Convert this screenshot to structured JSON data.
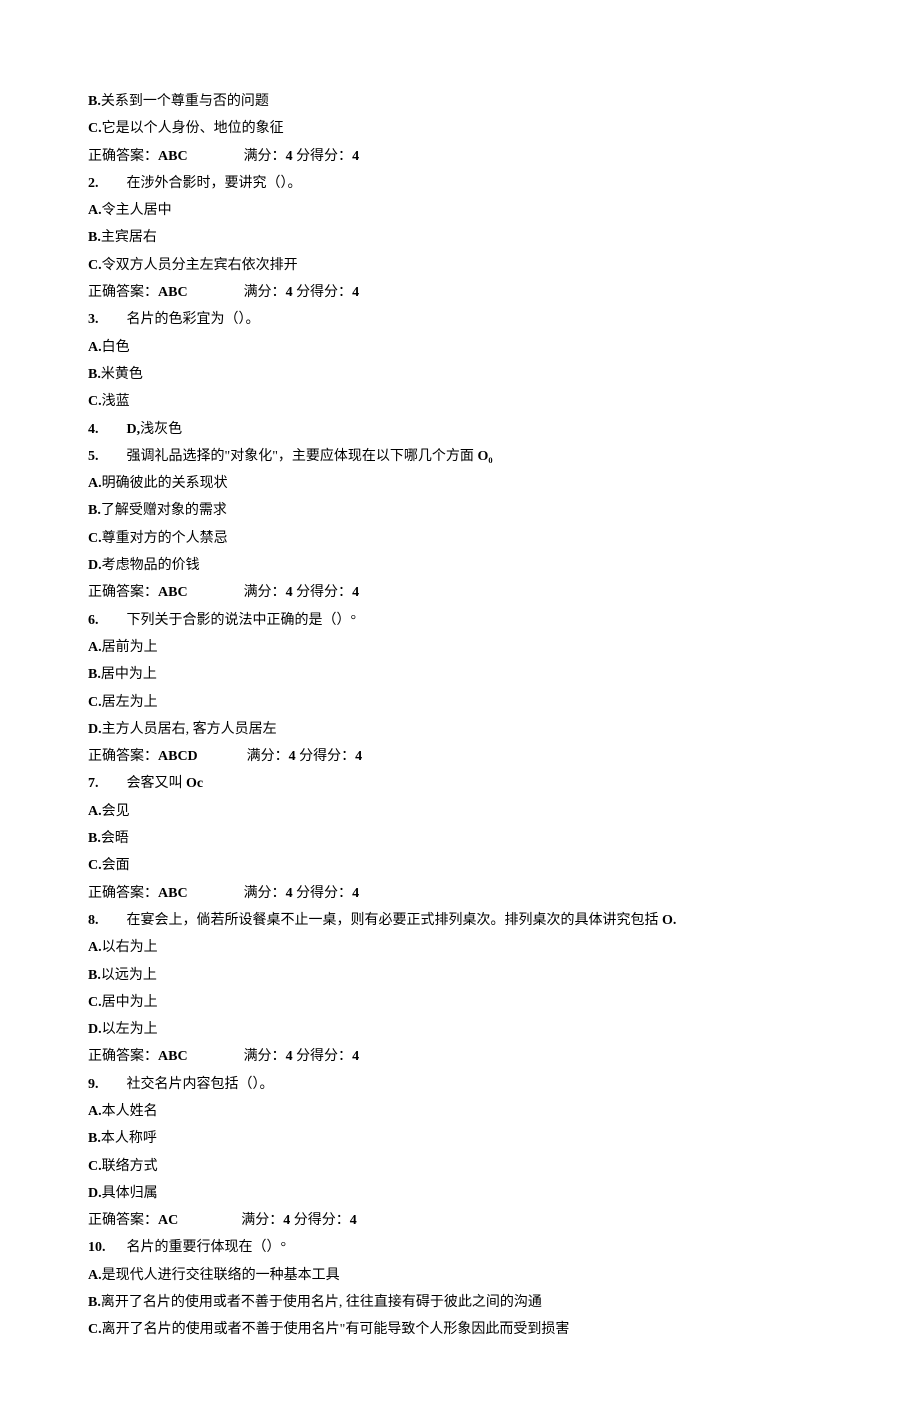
{
  "lines": [
    {
      "segments": [
        {
          "text": "B.",
          "bold": true
        },
        {
          "text": "关系到一个尊重与否的问题"
        }
      ]
    },
    {
      "segments": [
        {
          "text": "C.",
          "bold": true
        },
        {
          "text": "它是以个人身份、地位的象征"
        }
      ]
    },
    {
      "segments": [
        {
          "text": "正确答案：",
          "bold": false
        },
        {
          "text": "ABC",
          "bold": true
        },
        {
          "text": "                满分：",
          "bold": false
        },
        {
          "text": "4",
          "bold": true
        },
        {
          "text": " 分得分：",
          "bold": false
        },
        {
          "text": "4",
          "bold": true
        }
      ]
    },
    {
      "segments": [
        {
          "text": "2.",
          "bold": true
        },
        {
          "text": "        在涉外合影时，要讲究（）。"
        }
      ]
    },
    {
      "segments": [
        {
          "text": "A.",
          "bold": true
        },
        {
          "text": "令主人居中"
        }
      ]
    },
    {
      "segments": [
        {
          "text": "B.",
          "bold": true
        },
        {
          "text": "主宾居右"
        }
      ]
    },
    {
      "segments": [
        {
          "text": "C.",
          "bold": true
        },
        {
          "text": "令双方人员分主左宾右依次排开"
        }
      ]
    },
    {
      "segments": [
        {
          "text": "正确答案：",
          "bold": false
        },
        {
          "text": "ABC",
          "bold": true
        },
        {
          "text": "                满分：",
          "bold": false
        },
        {
          "text": "4",
          "bold": true
        },
        {
          "text": " 分得分：",
          "bold": false
        },
        {
          "text": "4",
          "bold": true
        }
      ]
    },
    {
      "segments": [
        {
          "text": "3.",
          "bold": true
        },
        {
          "text": "        名片的色彩宜为（）。"
        }
      ]
    },
    {
      "segments": [
        {
          "text": "A.",
          "bold": true
        },
        {
          "text": "白色"
        }
      ]
    },
    {
      "segments": [
        {
          "text": "B.",
          "bold": true
        },
        {
          "text": "米黄色"
        }
      ]
    },
    {
      "segments": [
        {
          "text": "C.",
          "bold": true
        },
        {
          "text": "浅蓝"
        }
      ]
    },
    {
      "segments": [
        {
          "text": "4.        D,",
          "bold": true
        },
        {
          "text": "浅灰色"
        }
      ]
    },
    {
      "segments": [
        {
          "text": "5.",
          "bold": true
        },
        {
          "text": "        强调礼品选择的\"对象化\"，主要应体现在以下哪几个方面 ",
          "bold": false
        },
        {
          "text": "O₀",
          "bold": true
        }
      ]
    },
    {
      "segments": [
        {
          "text": "A.",
          "bold": true
        },
        {
          "text": "明确彼此的关系现状"
        }
      ]
    },
    {
      "segments": [
        {
          "text": "B.",
          "bold": true
        },
        {
          "text": "了解受赠对象的需求"
        }
      ]
    },
    {
      "segments": [
        {
          "text": "C.",
          "bold": true
        },
        {
          "text": "尊重对方的个人禁忌"
        }
      ]
    },
    {
      "segments": [
        {
          "text": "D.",
          "bold": true
        },
        {
          "text": "考虑物品的价钱"
        }
      ]
    },
    {
      "segments": [
        {
          "text": "正确答案：",
          "bold": false
        },
        {
          "text": "ABC",
          "bold": true
        },
        {
          "text": "                满分：",
          "bold": false
        },
        {
          "text": "4",
          "bold": true
        },
        {
          "text": " 分得分：",
          "bold": false
        },
        {
          "text": "4",
          "bold": true
        }
      ]
    },
    {
      "segments": [
        {
          "text": "6.",
          "bold": true
        },
        {
          "text": "        下列关于合影的说法中正确的是（）°"
        }
      ]
    },
    {
      "segments": [
        {
          "text": "A.",
          "bold": true
        },
        {
          "text": "居前为上"
        }
      ]
    },
    {
      "segments": [
        {
          "text": "B.",
          "bold": true
        },
        {
          "text": "居中为上"
        }
      ]
    },
    {
      "segments": [
        {
          "text": "C.",
          "bold": true
        },
        {
          "text": "居左为上"
        }
      ]
    },
    {
      "segments": [
        {
          "text": "D.",
          "bold": true
        },
        {
          "text": "主方人员居右, 客方人员居左"
        }
      ]
    },
    {
      "segments": [
        {
          "text": "正确答案：",
          "bold": false
        },
        {
          "text": "ABCD",
          "bold": true
        },
        {
          "text": "              满分：",
          "bold": false
        },
        {
          "text": "4",
          "bold": true
        },
        {
          "text": " 分得分：",
          "bold": false
        },
        {
          "text": "4",
          "bold": true
        }
      ]
    },
    {
      "segments": [
        {
          "text": "7.",
          "bold": true
        },
        {
          "text": "        会客又叫 ",
          "bold": false
        },
        {
          "text": "Oc",
          "bold": true
        }
      ]
    },
    {
      "segments": [
        {
          "text": "A.",
          "bold": true
        },
        {
          "text": "会见"
        }
      ]
    },
    {
      "segments": [
        {
          "text": "B.",
          "bold": true
        },
        {
          "text": "会晤"
        }
      ]
    },
    {
      "segments": [
        {
          "text": "C.",
          "bold": true
        },
        {
          "text": "会面"
        }
      ]
    },
    {
      "segments": [
        {
          "text": "正确答案：",
          "bold": false
        },
        {
          "text": "ABC",
          "bold": true
        },
        {
          "text": "                满分：",
          "bold": false
        },
        {
          "text": "4",
          "bold": true
        },
        {
          "text": " 分得分：",
          "bold": false
        },
        {
          "text": "4",
          "bold": true
        }
      ]
    },
    {
      "segments": [
        {
          "text": "8.",
          "bold": true
        },
        {
          "text": "        在宴会上，倘若所设餐桌不止一桌，则有必要正式排列桌次。排列桌次的具体讲究包括 ",
          "bold": false
        },
        {
          "text": "O.",
          "bold": true
        }
      ]
    },
    {
      "segments": [
        {
          "text": "A.",
          "bold": true
        },
        {
          "text": "以右为上"
        }
      ]
    },
    {
      "segments": [
        {
          "text": "B.",
          "bold": true
        },
        {
          "text": "以远为上"
        }
      ]
    },
    {
      "segments": [
        {
          "text": "C.",
          "bold": true
        },
        {
          "text": "居中为上"
        }
      ]
    },
    {
      "segments": [
        {
          "text": "D.",
          "bold": true
        },
        {
          "text": "以左为上"
        }
      ]
    },
    {
      "segments": [
        {
          "text": "正确答案：",
          "bold": false
        },
        {
          "text": "ABC",
          "bold": true
        },
        {
          "text": "                满分：",
          "bold": false
        },
        {
          "text": "4",
          "bold": true
        },
        {
          "text": " 分得分：",
          "bold": false
        },
        {
          "text": "4",
          "bold": true
        }
      ]
    },
    {
      "segments": [
        {
          "text": "9.",
          "bold": true
        },
        {
          "text": "        社交名片内容包括（）。"
        }
      ]
    },
    {
      "segments": [
        {
          "text": "A.",
          "bold": true
        },
        {
          "text": "本人姓名"
        }
      ]
    },
    {
      "segments": [
        {
          "text": "B.",
          "bold": true
        },
        {
          "text": "本人称呼"
        }
      ]
    },
    {
      "segments": [
        {
          "text": "C.",
          "bold": true
        },
        {
          "text": "联络方式"
        }
      ]
    },
    {
      "segments": [
        {
          "text": "D.",
          "bold": true
        },
        {
          "text": "具体归属"
        }
      ]
    },
    {
      "segments": [
        {
          "text": "正确答案：",
          "bold": false
        },
        {
          "text": "AC",
          "bold": true
        },
        {
          "text": "                  满分：",
          "bold": false
        },
        {
          "text": "4",
          "bold": true
        },
        {
          "text": " 分得分：",
          "bold": false
        },
        {
          "text": "4",
          "bold": true
        }
      ]
    },
    {
      "segments": [
        {
          "text": "10.",
          "bold": true
        },
        {
          "text": "      名片的重要行体现在（）°"
        }
      ]
    },
    {
      "segments": [
        {
          "text": "A.",
          "bold": true
        },
        {
          "text": "是现代人进行交往联络的一种基本工具"
        }
      ]
    },
    {
      "segments": [
        {
          "text": "B.",
          "bold": true
        },
        {
          "text": "离开了名片的使用或者不善于使用名片, 往往直接有碍于彼此之间的沟通"
        }
      ]
    },
    {
      "segments": [
        {
          "text": "C.",
          "bold": true
        },
        {
          "text": "离开了名片的使用或者不善于使用名片\"有可能导致个人形象因此而受到损害"
        }
      ]
    }
  ]
}
